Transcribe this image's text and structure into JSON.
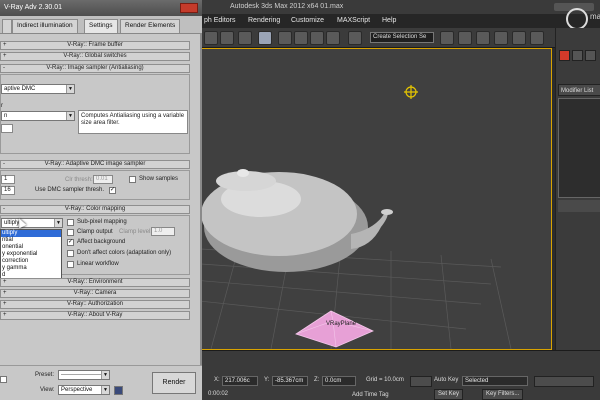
{
  "max_window": {
    "title": "Autodesk 3ds Max 2012 x64",
    "file": "01.max",
    "menu": [
      "ph Editors",
      "Rendering",
      "Customize",
      "MAXScript",
      "Help"
    ],
    "named_selection": "Create Selection Se",
    "logo_text": "matt g",
    "command_panel": {
      "modifier_list": "Modifier List"
    },
    "status": {
      "x_label": "X:",
      "x_value": "217.006c",
      "y_label": "Y:",
      "y_value": "-85.367cm",
      "z_label": "Z:",
      "z_value": "0.0cm",
      "grid": "Grid = 10.0cm",
      "auto_key": "Auto Key",
      "auto_key_value": "Selected",
      "set_key": "Set Key",
      "key_filters": "Key Filters...",
      "time": "0:00:02",
      "add_time_tag": "Add Time Tag"
    }
  },
  "viewport": {
    "plane_label": "VRayPlane",
    "accent": "#d9a300"
  },
  "dialog": {
    "title": "V-Ray Adv 2.30.01",
    "tabs": [
      "Indirect illumination",
      "Settings",
      "Render Elements"
    ],
    "rollouts": {
      "frame_buffer": "V-Ray:: Frame buffer",
      "global_switches": "V-Ray:: Global switches",
      "image_sampler": "V-Ray:: Image sampler (Antialiasing)",
      "adaptive_dmc": "V-Ray:: Adaptive DMC image sampler",
      "color_mapping": "V-Ray:: Color mapping",
      "environment": "V-Ray:: Environment",
      "camera": "V-Ray:: Camera",
      "authorization": "V-Ray:: Authorization",
      "about": "V-Ray:: About V-Ray"
    },
    "image_sampler": {
      "type_value": "aptive DMC",
      "filter_label": "r",
      "filter_value": "n",
      "filter_desc": "Computes Antialiasing using a variable size area filter."
    },
    "adaptive_dmc": {
      "clr_thresh_label": "Clr thresh:",
      "clr_thresh_value": "0.01",
      "min_value": "1",
      "max_value": "16",
      "show_samples": "Show samples",
      "use_dmc": "Use DMC sampler thresh."
    },
    "color_mapping": {
      "type_value": "ultiply",
      "type_options": [
        "ultiply",
        "ntial",
        "onential",
        "y exponential",
        "correction",
        "y gamma",
        "d"
      ],
      "sub_pixel": "Sub-pixel mapping",
      "clamp_output": "Clamp output",
      "clamp_level_label": "Clamp level:",
      "clamp_level_value": "1.0",
      "affect_background": "Affect background",
      "dont_affect": "Don't affect colors (adaptation only)",
      "linear_workflow": "Linear workflow"
    },
    "bottom": {
      "preset_label": "Preset:",
      "preset_value": "--------------------",
      "view_label": "View:",
      "view_value": "Perspective",
      "render": "Render"
    }
  }
}
